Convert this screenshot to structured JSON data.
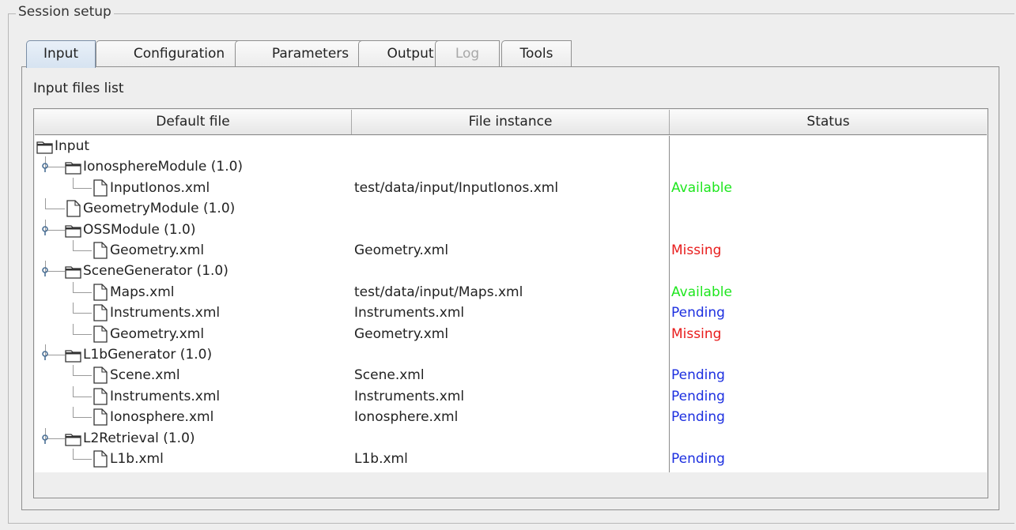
{
  "group": {
    "title": "Session setup"
  },
  "tabs": [
    {
      "label": "Input",
      "state": "active"
    },
    {
      "label": "Configuration",
      "state": "normal"
    },
    {
      "label": "Parameters",
      "state": "normal"
    },
    {
      "label": "Output",
      "state": "normal"
    },
    {
      "label": "Log",
      "state": "disabled"
    },
    {
      "label": "Tools",
      "state": "normal"
    }
  ],
  "panel": {
    "label": "Input files list"
  },
  "table": {
    "columns": [
      "Default file",
      "File instance",
      "Status"
    ],
    "rows": [
      {
        "name": "Input",
        "level": 0,
        "type": "folder",
        "handle": false,
        "instance": "",
        "status": "",
        "status_kind": ""
      },
      {
        "name": "IonosphereModule (1.0)",
        "level": 1,
        "type": "folder",
        "handle": true,
        "instance": "",
        "status": "",
        "status_kind": ""
      },
      {
        "name": "InputIonos.xml",
        "level": 2,
        "type": "file",
        "handle": false,
        "instance": "test/data/input/InputIonos.xml",
        "status": "Available",
        "status_kind": "available"
      },
      {
        "name": "GeometryModule (1.0)",
        "level": 1,
        "type": "file",
        "handle": false,
        "instance": "",
        "status": "",
        "status_kind": ""
      },
      {
        "name": "OSSModule (1.0)",
        "level": 1,
        "type": "folder",
        "handle": true,
        "instance": "",
        "status": "",
        "status_kind": ""
      },
      {
        "name": "Geometry.xml",
        "level": 2,
        "type": "file",
        "handle": false,
        "instance": "Geometry.xml",
        "status": "Missing",
        "status_kind": "missing"
      },
      {
        "name": "SceneGenerator (1.0)",
        "level": 1,
        "type": "folder",
        "handle": true,
        "instance": "",
        "status": "",
        "status_kind": ""
      },
      {
        "name": "Maps.xml",
        "level": 2,
        "type": "file",
        "handle": false,
        "instance": "test/data/input/Maps.xml",
        "status": "Available",
        "status_kind": "available"
      },
      {
        "name": "Instruments.xml",
        "level": 2,
        "type": "file",
        "handle": false,
        "instance": "Instruments.xml",
        "status": "Pending",
        "status_kind": "pending"
      },
      {
        "name": "Geometry.xml",
        "level": 2,
        "type": "file",
        "handle": false,
        "instance": "Geometry.xml",
        "status": "Missing",
        "status_kind": "missing"
      },
      {
        "name": "L1bGenerator (1.0)",
        "level": 1,
        "type": "folder",
        "handle": true,
        "instance": "",
        "status": "",
        "status_kind": ""
      },
      {
        "name": "Scene.xml",
        "level": 2,
        "type": "file",
        "handle": false,
        "instance": "Scene.xml",
        "status": "Pending",
        "status_kind": "pending"
      },
      {
        "name": "Instruments.xml",
        "level": 2,
        "type": "file",
        "handle": false,
        "instance": "Instruments.xml",
        "status": "Pending",
        "status_kind": "pending"
      },
      {
        "name": "Ionosphere.xml",
        "level": 2,
        "type": "file",
        "handle": false,
        "instance": "Ionosphere.xml",
        "status": "Pending",
        "status_kind": "pending"
      },
      {
        "name": "L2Retrieval (1.0)",
        "level": 1,
        "type": "folder",
        "handle": true,
        "instance": "",
        "status": "",
        "status_kind": ""
      },
      {
        "name": "L1b.xml",
        "level": 2,
        "type": "file",
        "handle": false,
        "instance": "L1b.xml",
        "status": "Pending",
        "status_kind": "pending"
      }
    ]
  },
  "colors": {
    "available": "#1ee61e",
    "missing": "#e81c1c",
    "pending": "#1c2fe0"
  },
  "icons": {
    "folder": "folder-icon",
    "file": "file-icon",
    "handle": "tree-handle-icon"
  }
}
